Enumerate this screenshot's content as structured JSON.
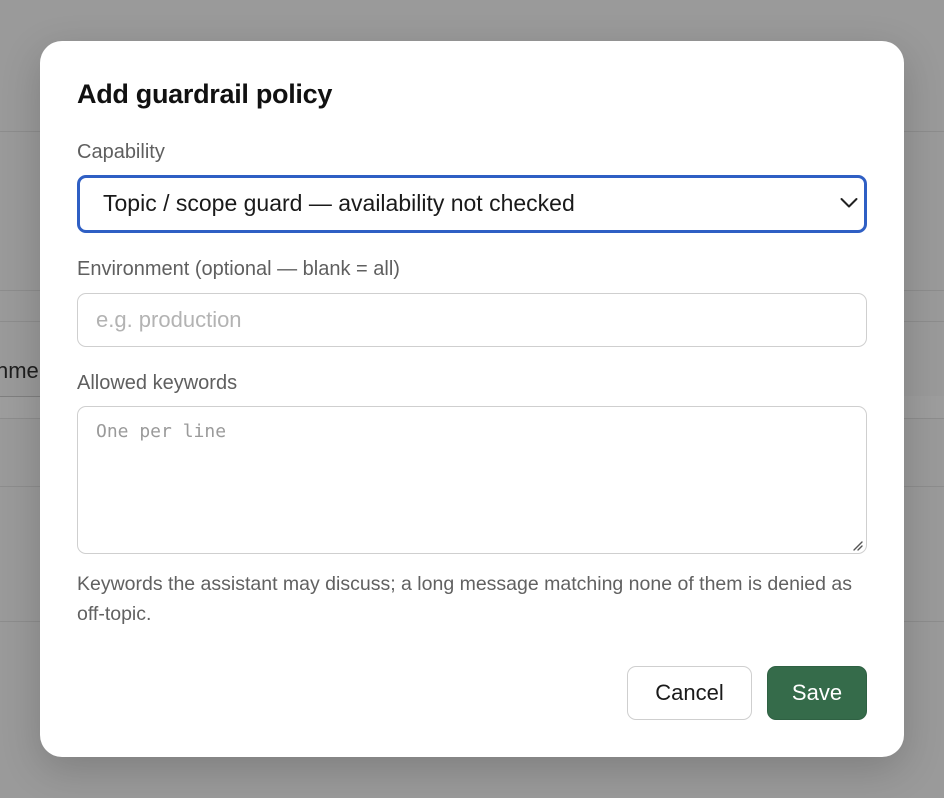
{
  "background": {
    "partial_text": "nme"
  },
  "dialog": {
    "title": "Add guardrail policy",
    "capability": {
      "label": "Capability",
      "selected": "Topic / scope guard — availability not checked"
    },
    "environment": {
      "label": "Environment (optional — blank = all)",
      "placeholder": "e.g. production",
      "value": ""
    },
    "keywords": {
      "label": "Allowed keywords",
      "placeholder": "One per line",
      "value": "",
      "help": "Keywords the assistant may discuss; a long message matching none of them is denied as off-topic."
    },
    "buttons": {
      "cancel": "Cancel",
      "save": "Save"
    }
  },
  "icons": {
    "select_chevron": "chevron-down-icon",
    "textarea_resize": "resize-grip-icon"
  },
  "colors": {
    "accent_focus": "#2f5fc4",
    "primary_button": "#356b4a",
    "overlay": "#9a9a9a"
  }
}
